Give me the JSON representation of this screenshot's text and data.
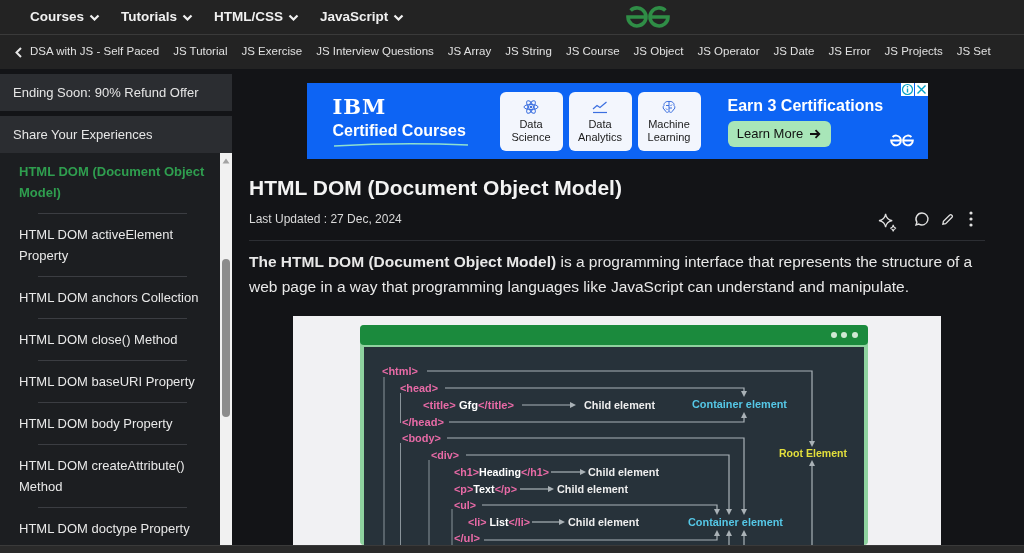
{
  "top_nav": {
    "menus": [
      "Courses",
      "Tutorials",
      "HTML/CSS",
      "JavaScript"
    ]
  },
  "sub_nav": {
    "items": [
      "DSA with JS - Self Paced",
      "JS Tutorial",
      "JS Exercise",
      "JS Interview Questions",
      "JS Array",
      "JS String",
      "JS Course",
      "JS Object",
      "JS Operator",
      "JS Date",
      "JS Error",
      "JS Projects",
      "JS Set"
    ]
  },
  "sidebar": {
    "promos": [
      "Ending Soon: 90% Refund Offer",
      "Share Your Experiences"
    ],
    "items": [
      {
        "label": "HTML DOM (Document Object Model)",
        "selected": true
      },
      {
        "label": "HTML DOM activeElement Property",
        "selected": false
      },
      {
        "label": "HTML DOM anchors Collection",
        "selected": false
      },
      {
        "label": "HTML DOM close() Method",
        "selected": false
      },
      {
        "label": "HTML DOM baseURI Property",
        "selected": false
      },
      {
        "label": "HTML DOM body Property",
        "selected": false
      },
      {
        "label": "HTML DOM createAttribute() Method",
        "selected": false
      },
      {
        "label": "HTML DOM doctype Property",
        "selected": false
      }
    ]
  },
  "ad": {
    "brand": "IBM",
    "headline": "Certified Courses",
    "cards": [
      {
        "kind": "atom",
        "label": "Data Science"
      },
      {
        "kind": "chart",
        "label": "Data Analytics"
      },
      {
        "kind": "brain",
        "label": "Machine Learning"
      }
    ],
    "title": "Earn 3 Certifications",
    "button": "Learn More"
  },
  "article": {
    "title": "HTML DOM (Document Object Model)",
    "updated": "Last Updated : 27 Dec, 2024",
    "intro": "**The HTML DOM (Document Object Model)** is a programming interface that represents the structure of a web page in a way that programming languages like JavaScript can understand and manipulate.",
    "figure": {
      "code_lines": [
        {
          "parts": [
            {
              "kind": "tag",
              "text": "<html>"
            }
          ]
        },
        {
          "parts": [
            {
              "kind": "tag",
              "text": "<head>"
            }
          ]
        },
        {
          "parts": [
            {
              "kind": "tag",
              "text": "<title>"
            },
            {
              "kind": "text",
              "text": " Gfg"
            },
            {
              "kind": "tag",
              "text": "</title>"
            }
          ]
        },
        {
          "parts": [
            {
              "kind": "tag",
              "text": "</head>"
            }
          ]
        },
        {
          "parts": [
            {
              "kind": "tag",
              "text": "<body>"
            }
          ]
        },
        {
          "parts": [
            {
              "kind": "tag",
              "text": "<div>"
            }
          ]
        },
        {
          "parts": [
            {
              "kind": "tag",
              "text": "<h1>"
            },
            {
              "kind": "text",
              "text": "Heading"
            },
            {
              "kind": "tag",
              "text": "</h1>"
            }
          ]
        },
        {
          "parts": [
            {
              "kind": "tag",
              "text": "<p>"
            },
            {
              "kind": "text",
              "text": "Text"
            },
            {
              "kind": "tag",
              "text": "</p>"
            }
          ]
        },
        {
          "parts": [
            {
              "kind": "tag",
              "text": "<ul>"
            }
          ]
        },
        {
          "parts": [
            {
              "kind": "tag",
              "text": "<li>"
            },
            {
              "kind": "text",
              "text": " List"
            },
            {
              "kind": "tag",
              "text": "</li>"
            }
          ]
        },
        {
          "parts": [
            {
              "kind": "tag",
              "text": "</ul>"
            }
          ]
        }
      ],
      "labels": [
        {
          "kind": "child",
          "text": "Child element"
        },
        {
          "kind": "container",
          "text": "Container element"
        },
        {
          "kind": "root",
          "text": "Root Element"
        },
        {
          "kind": "child",
          "text": "Child element"
        },
        {
          "kind": "child",
          "text": "Child element"
        },
        {
          "kind": "child",
          "text": "Child element"
        },
        {
          "kind": "container",
          "text": "Container element"
        }
      ]
    }
  }
}
